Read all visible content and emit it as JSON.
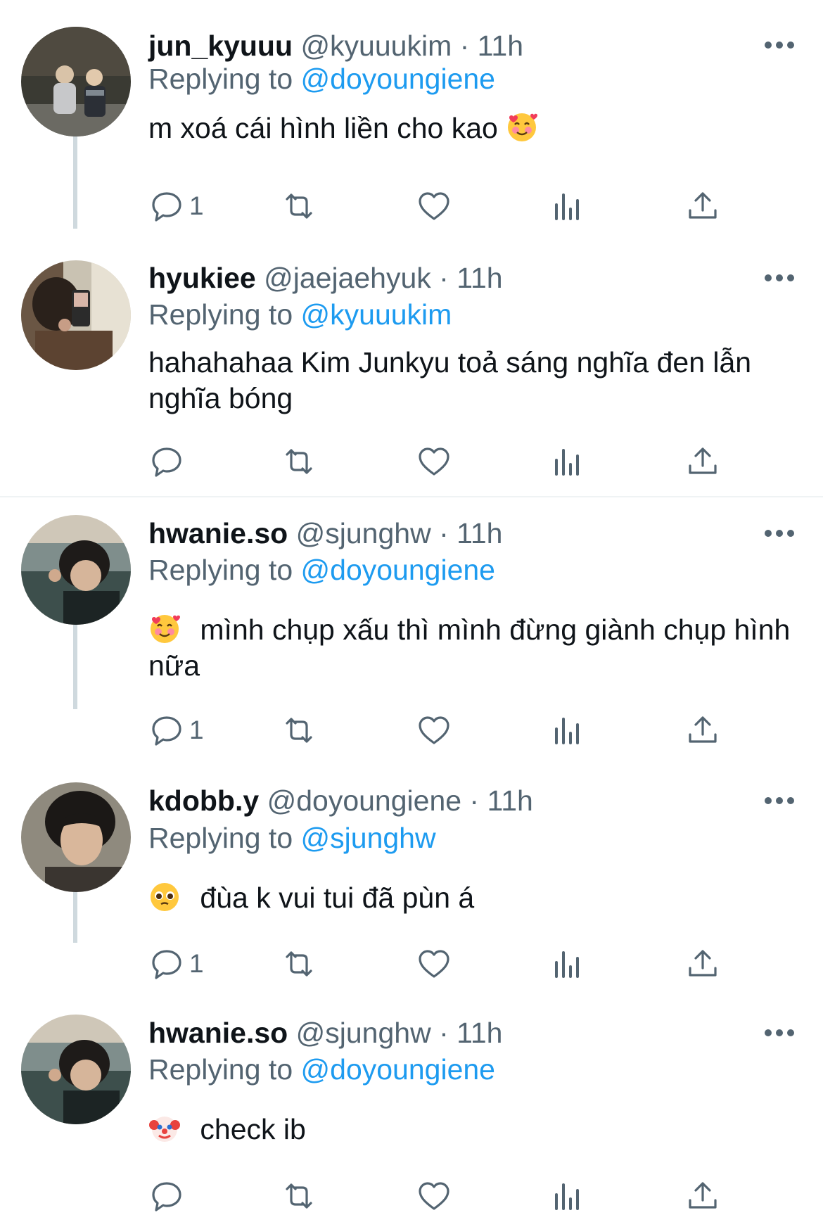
{
  "tweets": [
    {
      "name": "jun_kyuuu",
      "meta": "@kyuuukim · 11h",
      "replying_label": "Replying to",
      "replying_handle": "@doyoungiene",
      "text": "m xoá cái hình liền cho kao",
      "emoji": "smiling-face-with-hearts",
      "reply_count": "1"
    },
    {
      "name": "hyukiee",
      "meta": "@jaejaehyuk · 11h",
      "replying_label": "Replying to",
      "replying_handle": "@kyuuukim",
      "text": "hahahahaa Kim Junkyu toả sáng nghĩa đen lẫn nghĩa bóng",
      "reply_count": ""
    },
    {
      "name": "hwanie.so",
      "meta": "@sjunghw · 11h",
      "replying_label": "Replying to",
      "replying_handle": "@doyoungiene",
      "text": "mình chụp xấu thì mình đừng giành chụp hình nữa",
      "emoji": "smiling-face-with-hearts",
      "reply_count": "1"
    },
    {
      "name": "kdobb.y",
      "meta": "@doyoungiene · 11h",
      "replying_label": "Replying to",
      "replying_handle": "@sjunghw",
      "text": "đùa k vui tui đã pùn á",
      "emoji": "pleading-face",
      "reply_count": "1"
    },
    {
      "name": "hwanie.so",
      "meta": "@sjunghw · 11h",
      "replying_label": "Replying to",
      "replying_handle": "@doyoungiene",
      "text": "check ib",
      "emoji": "clown-face",
      "reply_count": ""
    }
  ],
  "icons": {
    "more": "more-horizontal-icon",
    "reply": "reply-bubble-icon",
    "retweet": "retweet-icon",
    "like": "heart-icon",
    "views": "views-chart-icon",
    "share": "share-upload-icon"
  },
  "colors": {
    "link": "#1d9bf0",
    "secondary": "#536471",
    "icon": "#536471",
    "thread_line": "#cfd9de"
  }
}
